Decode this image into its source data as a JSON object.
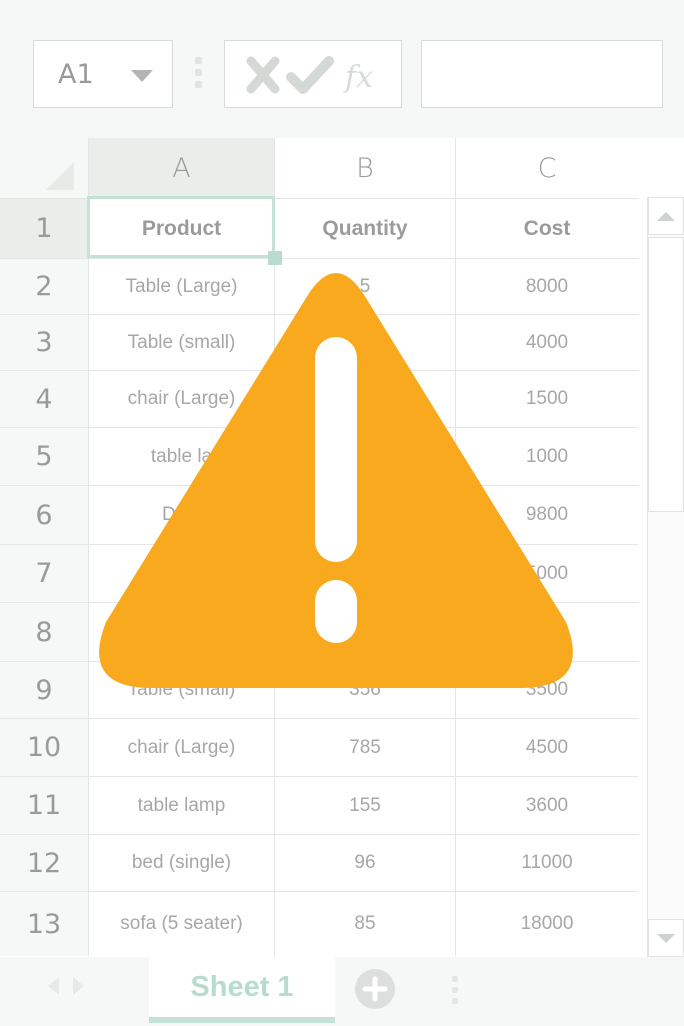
{
  "formula_bar": {
    "name_box": "A1",
    "icons": [
      "cancel-icon",
      "confirm-icon",
      "function-icon"
    ],
    "fx_label": "fx",
    "input_value": ""
  },
  "columns": [
    "A",
    "B",
    "C"
  ],
  "rows": [
    {
      "num": "1",
      "a": "Product",
      "b": "Quantity",
      "c": "Cost"
    },
    {
      "num": "2",
      "a": "Table (Large)",
      "b": "5",
      "c": "8000"
    },
    {
      "num": "3",
      "a": "Table (small)",
      "b": "",
      "c": "4000"
    },
    {
      "num": "4",
      "a": "chair (Large)",
      "b": "",
      "c": "1500"
    },
    {
      "num": "5",
      "a": "table la",
      "b": "",
      "c": "1000"
    },
    {
      "num": "6",
      "a": "Dinir",
      "b": "",
      "c": "9800"
    },
    {
      "num": "7",
      "a": "s",
      "b": "",
      "c": "5000"
    },
    {
      "num": "8",
      "a": "",
      "b": "",
      "c": ""
    },
    {
      "num": "9",
      "a": "Table (small)",
      "b": "356",
      "c": "3500"
    },
    {
      "num": "10",
      "a": "chair (Large)",
      "b": "785",
      "c": "4500"
    },
    {
      "num": "11",
      "a": "table lamp",
      "b": "155",
      "c": "3600"
    },
    {
      "num": "12",
      "a": "bed (single)",
      "b": "96",
      "c": "11000"
    },
    {
      "num": "13",
      "a": "sofa (5 seater)",
      "b": "85",
      "c": "18000"
    }
  ],
  "sheet_tabs": {
    "active": "Sheet 1",
    "add_icon": "plus-circle-icon"
  },
  "overlay": {
    "icon": "warning-icon",
    "color": "#f9a91e"
  },
  "colors": {
    "selection": "#c4e2d6",
    "tab_text": "#b6dccd"
  }
}
